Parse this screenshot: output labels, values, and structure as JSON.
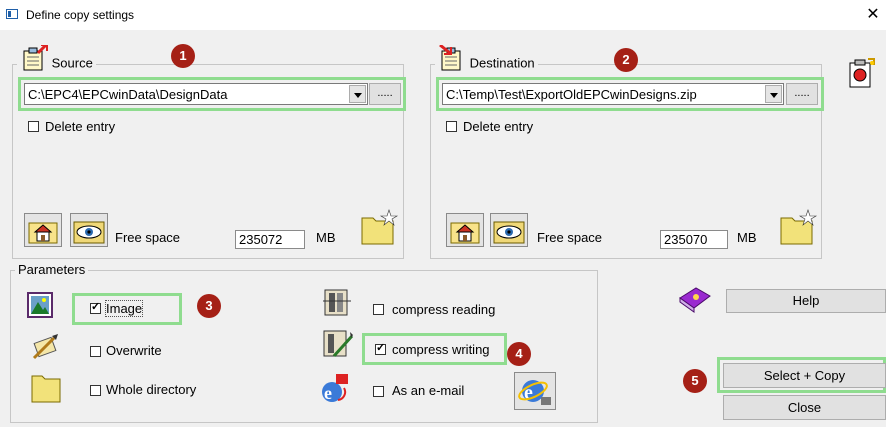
{
  "window": {
    "title": "Define copy settings",
    "close": "✕"
  },
  "source": {
    "legend": "Source",
    "path": "C:\\EPC4\\EPCwinData\\DesignData",
    "browse": ".....",
    "delete_entry": "Delete entry",
    "free_space_label": "Free space",
    "free_space_value": "235072",
    "unit": "MB"
  },
  "destination": {
    "legend": "Destination",
    "path": "C:\\Temp\\Test\\ExportOldEPCwinDesigns.zip",
    "browse": ".....",
    "delete_entry": "Delete entry",
    "free_space_label": "Free space",
    "free_space_value": "235070",
    "unit": "MB"
  },
  "parameters": {
    "legend": "Parameters",
    "image": "Image",
    "overwrite": "Overwrite",
    "whole_directory": "Whole directory",
    "compress_reading": "compress reading",
    "compress_writing": "compress writing",
    "as_email": "As an e-mail"
  },
  "buttons": {
    "help": "Help",
    "select_copy": "Select + Copy",
    "close": "Close"
  },
  "badges": [
    "1",
    "2",
    "3",
    "4",
    "5"
  ],
  "colors": {
    "highlight": "#8fdc8f",
    "badge": "#a52016",
    "titlebar_bg": "#ffffff"
  }
}
